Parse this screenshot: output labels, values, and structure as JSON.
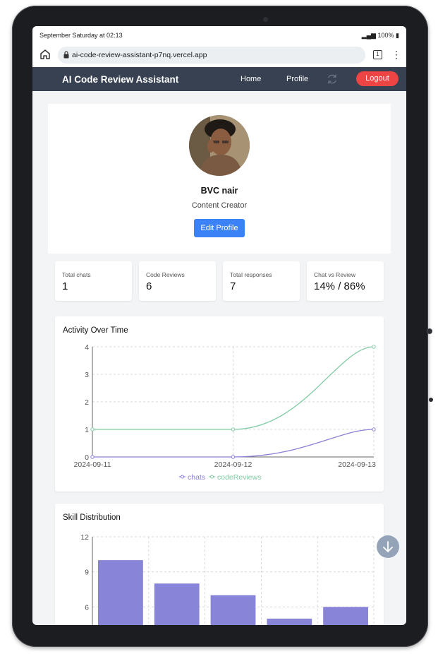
{
  "status_bar": {
    "time": "September Saturday at 02:13",
    "battery": "100%"
  },
  "browser": {
    "url": "ai-code-review-assistant-p7nq.vercel.app",
    "tab_count": "1"
  },
  "navbar": {
    "brand": "AI Code Review Assistant",
    "home": "Home",
    "profile": "Profile",
    "logout": "Logout"
  },
  "profile": {
    "name": "BVC nair",
    "role": "Content Creator",
    "edit_label": "Edit Profile"
  },
  "stats": [
    {
      "label": "Total chats",
      "value": "1"
    },
    {
      "label": "Code Reviews",
      "value": "6"
    },
    {
      "label": "Total responses",
      "value": "7"
    },
    {
      "label": "Chat vs Review",
      "value": "14% / 86%"
    }
  ],
  "colors": {
    "navbar": "#374151",
    "logout": "#ef4444",
    "primary": "#3b82f6",
    "chats_line": "#8b80d6",
    "code_reviews_line": "#82caa4",
    "bar": "#8884d8"
  },
  "chart_data": [
    {
      "type": "line",
      "title": "Activity Over Time",
      "x": [
        "2024-09-11",
        "2024-09-12",
        "2024-09-13"
      ],
      "series": [
        {
          "name": "chats",
          "values": [
            0,
            0,
            1
          ]
        },
        {
          "name": "codeReviews",
          "values": [
            1,
            1,
            4
          ]
        }
      ],
      "ylim": [
        0,
        4
      ],
      "yticks": [
        0,
        1,
        2,
        3,
        4
      ],
      "grid": true,
      "legend": "bottom"
    },
    {
      "type": "bar",
      "title": "Skill Distribution",
      "categories": [
        "",
        "",
        "",
        "",
        ""
      ],
      "values": [
        10,
        8,
        7,
        5,
        6
      ],
      "ylim": [
        0,
        12
      ],
      "yticks": [
        3,
        6,
        9,
        12
      ],
      "grid": true
    }
  ]
}
